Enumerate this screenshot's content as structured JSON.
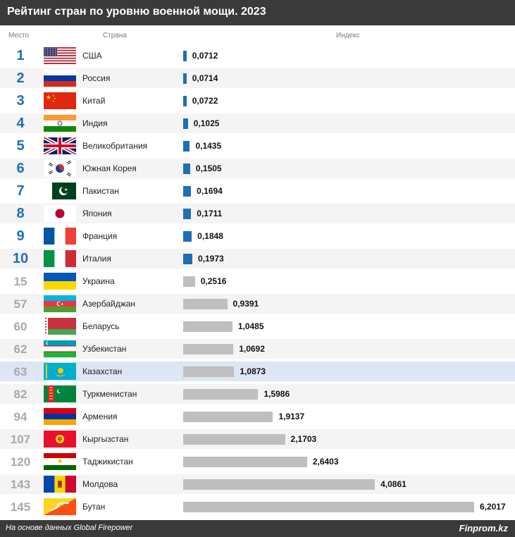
{
  "title": "Рейтинг стран по уровню военной мощи. 2023",
  "columns": {
    "rank": "Место",
    "country": "Страна",
    "index": "Индекс"
  },
  "footer": {
    "source": "На основе данных Global Firepower",
    "brand": "Finprom.kz"
  },
  "colors": {
    "header_bg": "#3a3a3a",
    "top_bar": "#1f6fb5",
    "rest_bar": "#bfbfbf",
    "highlight_row": "#dce6f4",
    "top_rank": "#1f6fb5",
    "rest_rank": "#a8a8a8"
  },
  "chart_data": {
    "type": "bar",
    "orientation": "horizontal",
    "title": "Рейтинг стран по уровню военной мощи. 2023",
    "categories": [
      "США",
      "Россия",
      "Китай",
      "Индия",
      "Великобритания",
      "Южная Корея",
      "Пакистан",
      "Япония",
      "Франция",
      "Италия",
      "Украина",
      "Азербайджан",
      "Беларусь",
      "Узбекистан",
      "Казахстан",
      "Туркменистан",
      "Армения",
      "Кыргызстан",
      "Таджикистан",
      "Молдова",
      "Бутан"
    ],
    "ranks": [
      "1",
      "2",
      "3",
      "4",
      "5",
      "6",
      "7",
      "8",
      "9",
      "10",
      "15",
      "57",
      "60",
      "62",
      "63",
      "82",
      "94",
      "107",
      "120",
      "143",
      "145"
    ],
    "values": [
      0.0712,
      0.0714,
      0.0722,
      0.1025,
      0.1435,
      0.1505,
      0.1694,
      0.1711,
      0.1848,
      0.1973,
      0.2516,
      0.9391,
      1.0485,
      1.0692,
      1.0873,
      1.5986,
      1.9137,
      2.1703,
      2.6403,
      4.0861,
      6.2017
    ],
    "labels": [
      "0,0712",
      "0,0714",
      "0,0722",
      "0,1025",
      "0,1435",
      "0,1505",
      "0,1694",
      "0,1711",
      "0,1848",
      "0,1973",
      "0,2516",
      "0,9391",
      "1,0485",
      "1,0692",
      "1,0873",
      "1,5986",
      "1,9137",
      "2,1703",
      "2,6403",
      "4,0861",
      "6,2017"
    ],
    "flags": [
      "usa-flag",
      "russia-flag",
      "china-flag",
      "india-flag",
      "uk-flag",
      "south-korea-flag",
      "pakistan-flag",
      "japan-flag",
      "france-flag",
      "italy-flag",
      "ukraine-flag",
      "azerbaijan-flag",
      "belarus-flag",
      "uzbekistan-flag",
      "kazakhstan-flag",
      "turkmenistan-flag",
      "armenia-flag",
      "kyrgyzstan-flag",
      "tajikistan-flag",
      "moldova-flag",
      "bhutan-flag"
    ],
    "highlight": "Казахстан",
    "top_count": 10,
    "xlim": [
      0,
      6.2017
    ],
    "grid": false,
    "legend": "none"
  }
}
